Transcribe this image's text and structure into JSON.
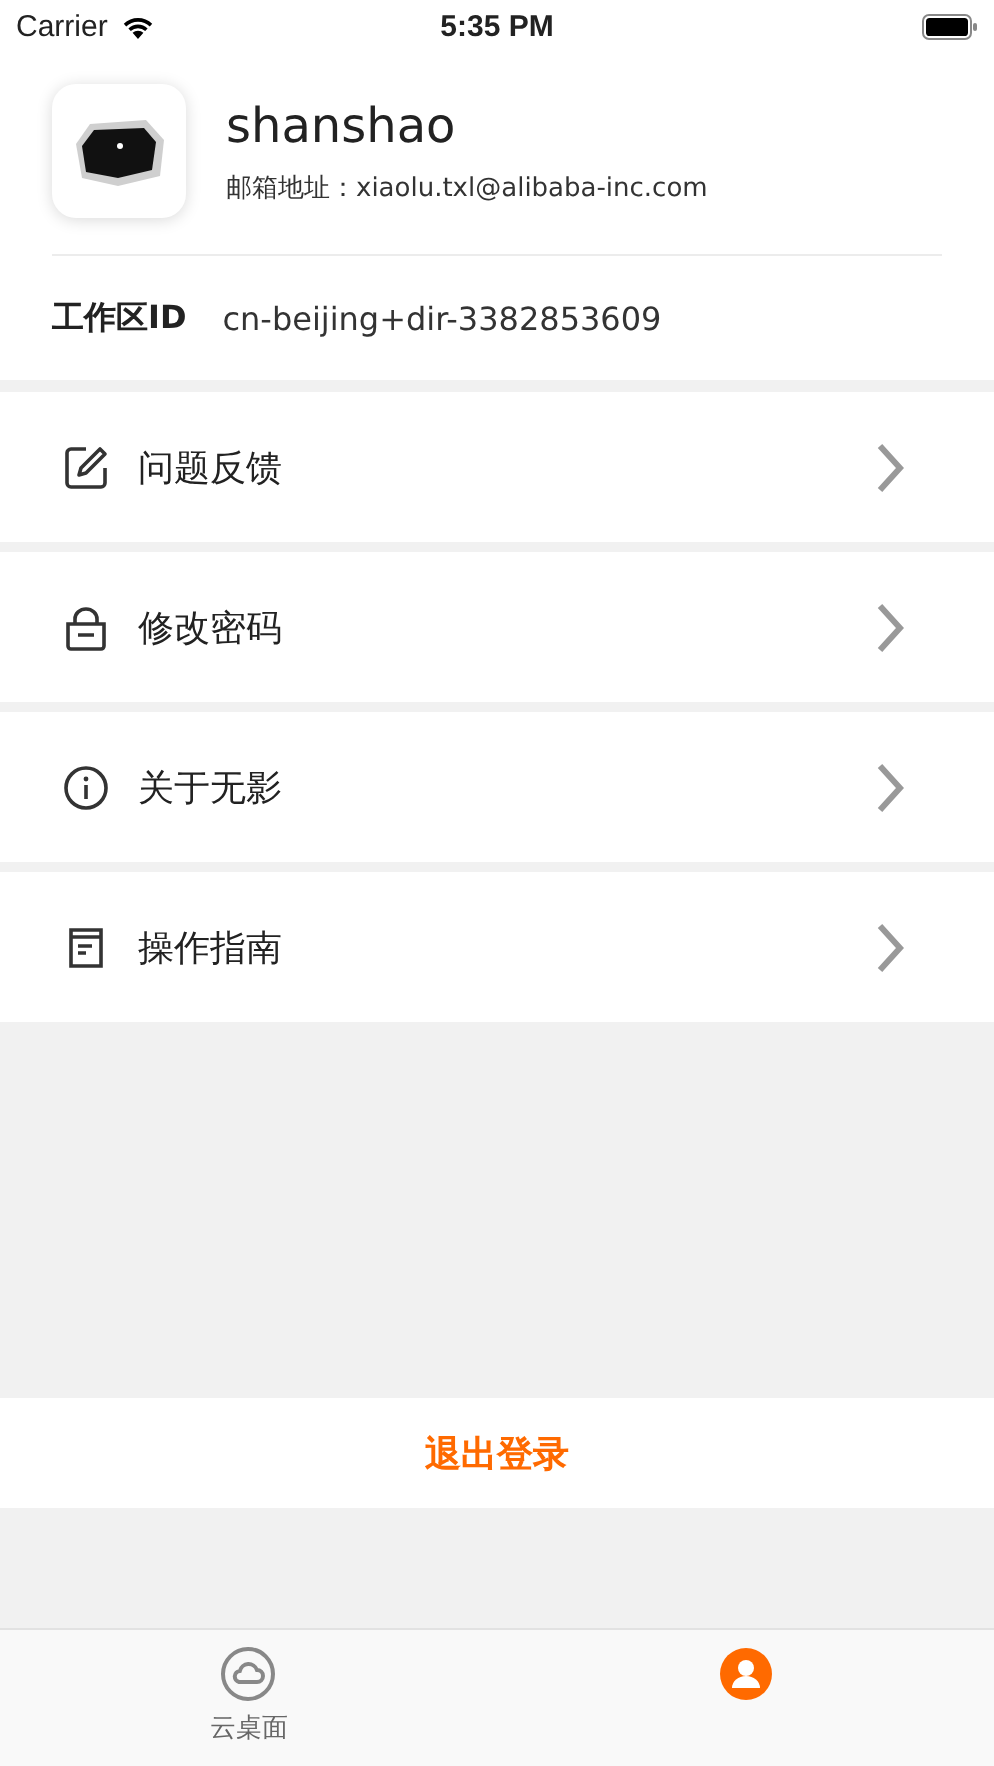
{
  "status_bar": {
    "carrier": "Carrier",
    "time": "5:35 PM"
  },
  "profile": {
    "name": "shanshao",
    "email": "邮箱地址：xiaolu.txl@alibaba-inc.com"
  },
  "workspace": {
    "label": "工作区ID",
    "value": "cn-beijing+dir-3382853609"
  },
  "menu": [
    {
      "kind": "edit",
      "label": "问题反馈"
    },
    {
      "kind": "lock",
      "label": "修改密码"
    },
    {
      "kind": "info",
      "label": "关于无影"
    },
    {
      "kind": "document",
      "label": "操作指南"
    }
  ],
  "logout": "退出登录",
  "tabs": [
    {
      "kind": "desktop",
      "label": "云桌面",
      "selected": false
    },
    {
      "kind": "profile",
      "selected": true
    }
  ]
}
